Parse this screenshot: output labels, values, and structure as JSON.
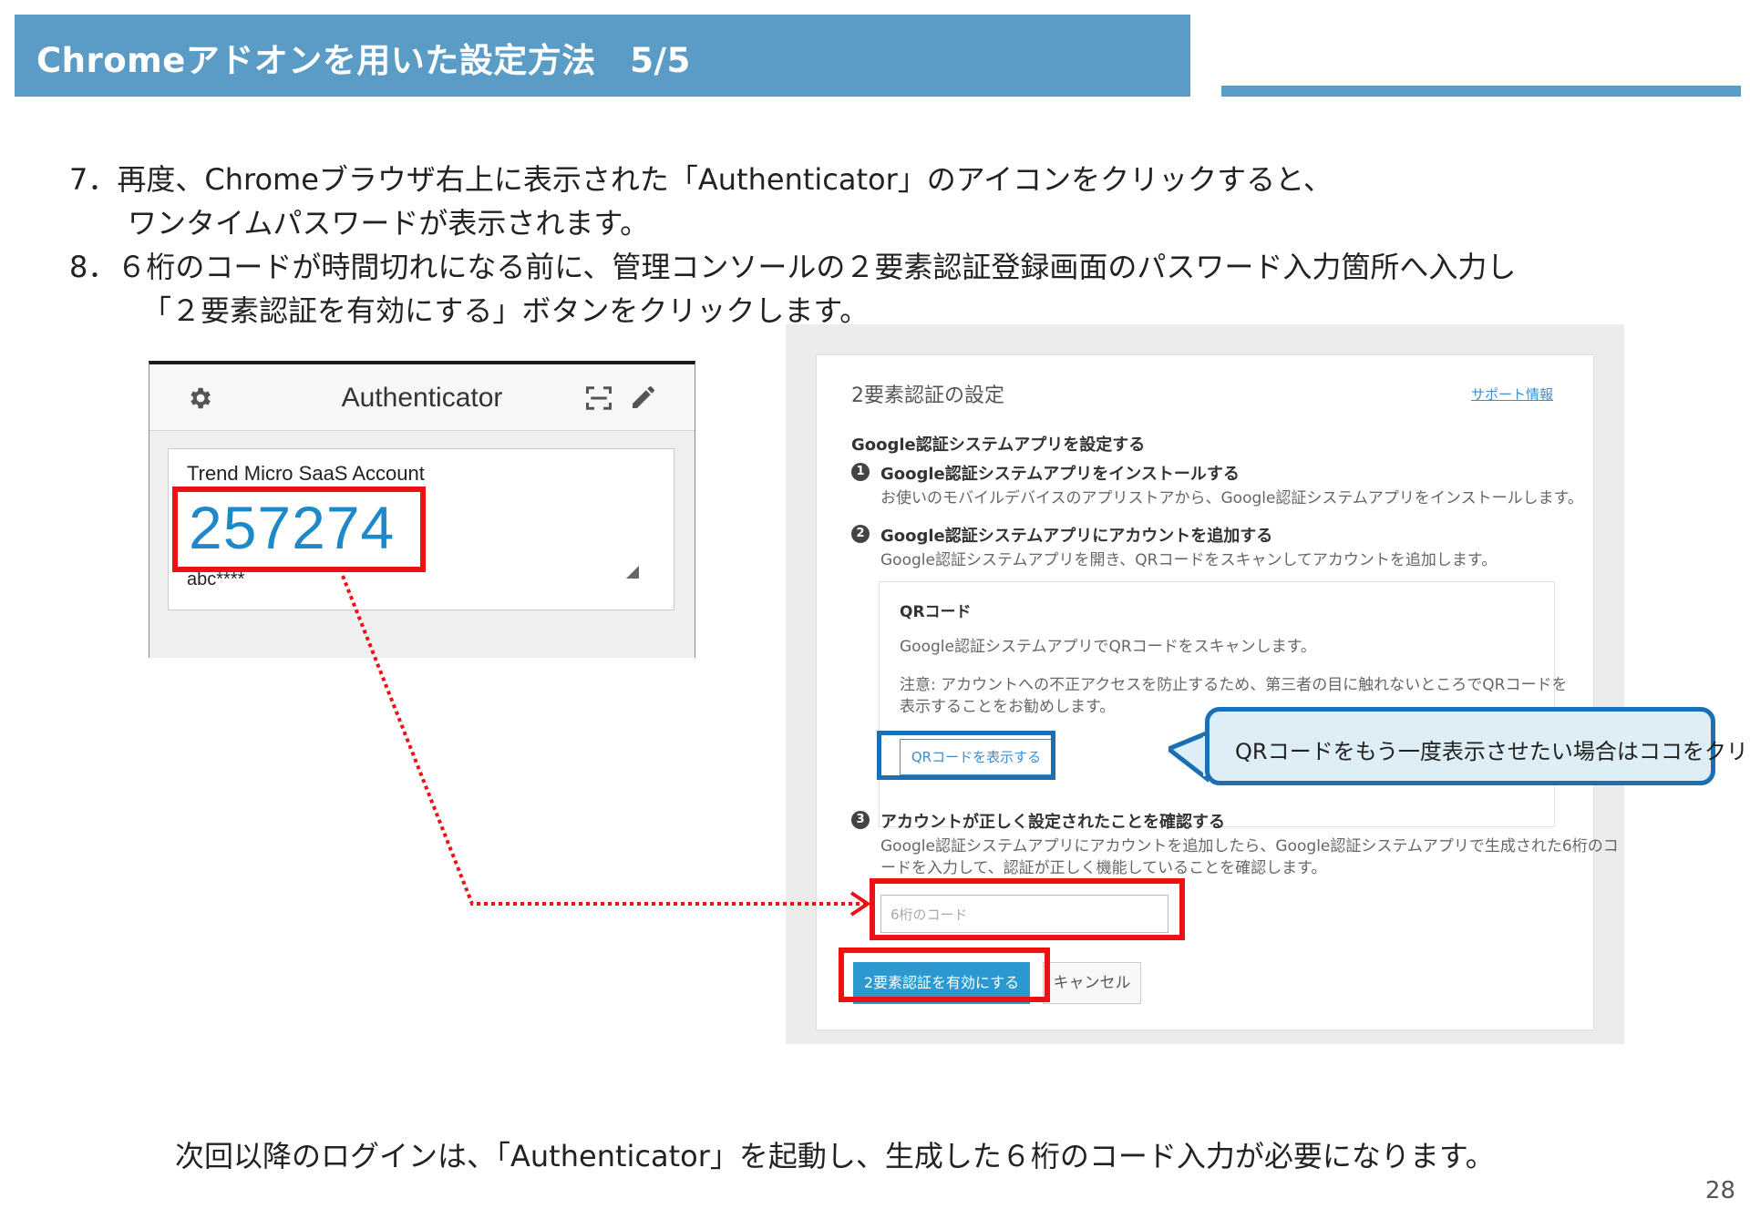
{
  "header": {
    "title": "Chromeアドオンを用いた設定方法　5/5"
  },
  "instructions": [
    "7．再度、Chromeブラウザ右上に表示された「Authenticator」のアイコンをクリックすると、",
    "ワンタイムパスワードが表示されます。",
    "8．６桁のコードが時間切れになる前に、管理コンソールの２要素認証登録画面のパスワード入力箇所へ入力し",
    "「２要素認証を有効にする」ボタンをクリックします。"
  ],
  "authenticator": {
    "title": "Authenticator",
    "account": "Trend Micro SaaS Account",
    "code": "257274",
    "user": "abc****"
  },
  "panel": {
    "heading": "2要素認証の設定",
    "support_link": "サポート情報",
    "section_title": "Google認証システムアプリを設定する",
    "step1_num": "1",
    "step1_title": "Google認証システムアプリをインストールする",
    "step1_desc": "お使いのモバイルデバイスのアプリストアから、Google認証システムアプリをインストールします。",
    "step2_num": "2",
    "step2_title": "Google認証システムアプリにアカウントを追加する",
    "step2_desc": "Google認証システムアプリを開き、QRコードをスキャンしてアカウントを追加します。",
    "qr": {
      "title": "QRコード",
      "desc": "Google認証システムアプリでQRコードをスキャンします。",
      "note_line1": "注意: アカウントへの不正アクセスを防止するため、第三者の目に触れないところでQRコードを",
      "note_line2": "表示することをお勧めします。",
      "button": "QRコードを表示する"
    },
    "step3_num": "3",
    "step3_title": "アカウントが正しく設定されたことを確認する",
    "step3_desc_line1": "Google認証システムアプリにアカウントを追加したら、Google認証システムアプリで生成された6桁のコ",
    "step3_desc_line2": "ードを入力して、認証が正しく機能していることを確認します。",
    "code_placeholder": "6桁のコード",
    "enable_button": "2要素認証を有効にする",
    "cancel_button": "キャンセル"
  },
  "callout": {
    "text": "QRコードをもう一度表示させたい場合はココをクリック"
  },
  "footer": {
    "text": "次回以降のログインは、「Authenticator」を起動し、生成した６桁のコード入力が必要になります。"
  },
  "page_number": "28",
  "colors": {
    "title_bar": "#5b9cc7",
    "highlight": "#ee1111",
    "callout_border": "#1c6fb3",
    "code": "#1e88c8"
  }
}
